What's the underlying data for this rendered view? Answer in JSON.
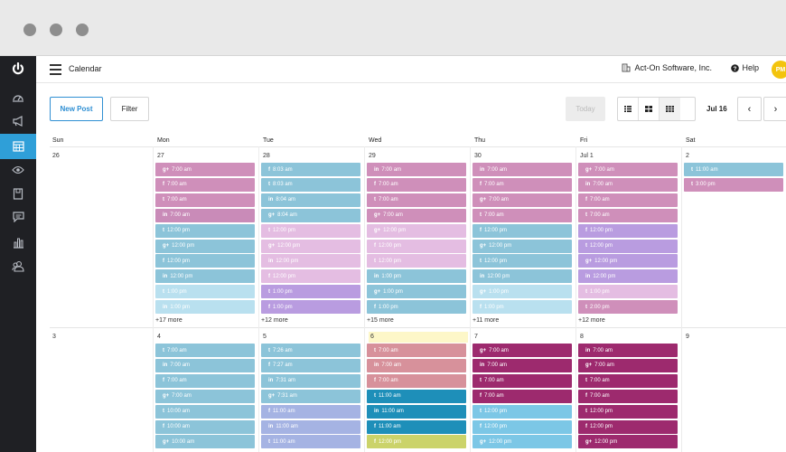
{
  "topbar": {
    "title": "Calendar",
    "company": "Act-On Software, Inc.",
    "help": "Help",
    "avatar": "PM"
  },
  "toolbar": {
    "new_post": "New Post",
    "filter": "Filter",
    "today": "Today",
    "range": "Jul 16",
    "prev": "‹",
    "next": "›"
  },
  "colors": {
    "facebook": "#7fb7d4",
    "twitter": "#8ec6da",
    "linkedin": "#d095bf",
    "google": "#cf8fb9",
    "highlight": "#fdf7c8"
  },
  "weekdays": [
    "Sun",
    "Mon",
    "Tue",
    "Wed",
    "Thu",
    "Fri",
    "Sat"
  ],
  "weeks": [
    {
      "dates": [
        "26",
        "27",
        "28",
        "29",
        "30",
        "Jul 1",
        "2"
      ],
      "days": [
        {
          "events": [],
          "more": ""
        },
        {
          "events": [
            {
              "icon": "g+",
              "time": "7:00 am",
              "color": "#cf8fba"
            },
            {
              "icon": "f",
              "time": "7:00 am",
              "color": "#cf8fba"
            },
            {
              "icon": "t",
              "time": "7:00 am",
              "color": "#cf8fba"
            },
            {
              "icon": "in",
              "time": "7:00 am",
              "color": "#c98bb8"
            },
            {
              "icon": "t",
              "time": "12:00 pm",
              "color": "#8cc4d9"
            },
            {
              "icon": "g+",
              "time": "12:00 pm",
              "color": "#8cc4d9"
            },
            {
              "icon": "f",
              "time": "12:00 pm",
              "color": "#8cc4d9"
            },
            {
              "icon": "in",
              "time": "12:00 pm",
              "color": "#8cc4d9"
            },
            {
              "icon": "t",
              "time": "1:00 pm",
              "color": "#b9e0ef"
            },
            {
              "icon": "in",
              "time": "1:00 pm",
              "color": "#b9e0ef"
            }
          ],
          "more": "+17 more"
        },
        {
          "events": [
            {
              "icon": "f",
              "time": "8:03 am",
              "color": "#8cc4d9"
            },
            {
              "icon": "t",
              "time": "8:03 am",
              "color": "#8cc4d9"
            },
            {
              "icon": "in",
              "time": "8:04 am",
              "color": "#8cc4d9"
            },
            {
              "icon": "g+",
              "time": "8:04 am",
              "color": "#8cc4d9"
            },
            {
              "icon": "t",
              "time": "12:00 pm",
              "color": "#e4bde2"
            },
            {
              "icon": "g+",
              "time": "12:00 pm",
              "color": "#e4bde2"
            },
            {
              "icon": "in",
              "time": "12:00 pm",
              "color": "#e4bde2"
            },
            {
              "icon": "f",
              "time": "12:00 pm",
              "color": "#e4bde2"
            },
            {
              "icon": "t",
              "time": "1:00 pm",
              "color": "#b99ce0"
            },
            {
              "icon": "f",
              "time": "1:00 pm",
              "color": "#b99ce0"
            }
          ],
          "more": "+12 more"
        },
        {
          "events": [
            {
              "icon": "in",
              "time": "7:00 am",
              "color": "#cf8fba"
            },
            {
              "icon": "f",
              "time": "7:00 am",
              "color": "#cf8fba"
            },
            {
              "icon": "t",
              "time": "7:00 am",
              "color": "#cf8fba"
            },
            {
              "icon": "g+",
              "time": "7:00 am",
              "color": "#cf8fba"
            },
            {
              "icon": "g+",
              "time": "12:00 pm",
              "color": "#e4bde2"
            },
            {
              "icon": "f",
              "time": "12:00 pm",
              "color": "#e4bde2"
            },
            {
              "icon": "t",
              "time": "12:00 pm",
              "color": "#e4bde2"
            },
            {
              "icon": "in",
              "time": "1:00 pm",
              "color": "#8cc4d9"
            },
            {
              "icon": "g+",
              "time": "1:00 pm",
              "color": "#8cc4d9"
            },
            {
              "icon": "f",
              "time": "1:00 pm",
              "color": "#8cc4d9"
            }
          ],
          "more": "+15 more"
        },
        {
          "events": [
            {
              "icon": "in",
              "time": "7:00 am",
              "color": "#cf8fba"
            },
            {
              "icon": "f",
              "time": "7:00 am",
              "color": "#cf8fba"
            },
            {
              "icon": "g+",
              "time": "7:00 am",
              "color": "#cf8fba"
            },
            {
              "icon": "t",
              "time": "7:00 am",
              "color": "#cf8fba"
            },
            {
              "icon": "f",
              "time": "12:00 pm",
              "color": "#8cc4d9"
            },
            {
              "icon": "g+",
              "time": "12:00 pm",
              "color": "#8cc4d9"
            },
            {
              "icon": "t",
              "time": "12:00 pm",
              "color": "#8cc4d9"
            },
            {
              "icon": "in",
              "time": "12:00 pm",
              "color": "#8cc4d9"
            },
            {
              "icon": "g+",
              "time": "1:00 pm",
              "color": "#b9e0ef"
            },
            {
              "icon": "f",
              "time": "1:00 pm",
              "color": "#b9e0ef"
            }
          ],
          "more": "+11 more"
        },
        {
          "events": [
            {
              "icon": "g+",
              "time": "7:00 am",
              "color": "#cf8fba"
            },
            {
              "icon": "in",
              "time": "7:00 am",
              "color": "#cf8fba"
            },
            {
              "icon": "f",
              "time": "7:00 am",
              "color": "#cf8fba"
            },
            {
              "icon": "t",
              "time": "7:00 am",
              "color": "#cf8fba"
            },
            {
              "icon": "f",
              "time": "12:00 pm",
              "color": "#b99ce0"
            },
            {
              "icon": "t",
              "time": "12:00 pm",
              "color": "#b99ce0"
            },
            {
              "icon": "g+",
              "time": "12:00 pm",
              "color": "#b99ce0"
            },
            {
              "icon": "in",
              "time": "12:00 pm",
              "color": "#b99ce0"
            },
            {
              "icon": "t",
              "time": "1:00 pm",
              "color": "#e4bde2"
            },
            {
              "icon": "t",
              "time": "2:00 pm",
              "color": "#cf8fba"
            }
          ],
          "more": "+12 more"
        },
        {
          "events": [
            {
              "icon": "t",
              "time": "11:00 am",
              "color": "#8cc4d9"
            },
            {
              "icon": "t",
              "time": "3:00 pm",
              "color": "#cf8fba"
            }
          ],
          "more": ""
        }
      ]
    },
    {
      "dates": [
        "3",
        "4",
        "5",
        "6",
        "7",
        "8",
        "9"
      ],
      "days": [
        {
          "events": [],
          "more": ""
        },
        {
          "events": [
            {
              "icon": "t",
              "time": "7:00 am",
              "color": "#8cc4d9"
            },
            {
              "icon": "in",
              "time": "7:00 am",
              "color": "#8cc4d9"
            },
            {
              "icon": "f",
              "time": "7:00 am",
              "color": "#8cc4d9"
            },
            {
              "icon": "g+",
              "time": "7:00 am",
              "color": "#8cc4d9"
            },
            {
              "icon": "t",
              "time": "10:00 am",
              "color": "#8cc4d9"
            },
            {
              "icon": "f",
              "time": "10:00 am",
              "color": "#8cc4d9"
            },
            {
              "icon": "g+",
              "time": "10:00 am",
              "color": "#8cc4d9"
            }
          ],
          "more": ""
        },
        {
          "events": [
            {
              "icon": "t",
              "time": "7:26 am",
              "color": "#8cc4d9"
            },
            {
              "icon": "f",
              "time": "7:27 am",
              "color": "#8cc4d9"
            },
            {
              "icon": "in",
              "time": "7:31 am",
              "color": "#8cc4d9"
            },
            {
              "icon": "g+",
              "time": "7:31 am",
              "color": "#8cc4d9"
            },
            {
              "icon": "f",
              "time": "11:00 am",
              "color": "#a5b3e3"
            },
            {
              "icon": "in",
              "time": "11:00 am",
              "color": "#a5b3e3"
            },
            {
              "icon": "t",
              "time": "11:00 am",
              "color": "#a5b3e3"
            }
          ],
          "more": ""
        },
        {
          "events": [
            {
              "icon": "t",
              "time": "7:00 am",
              "color": "#d7919b"
            },
            {
              "icon": "in",
              "time": "7:00 am",
              "color": "#d7919b"
            },
            {
              "icon": "f",
              "time": "7:00 am",
              "color": "#d7919b"
            },
            {
              "icon": "t",
              "time": "11:00 am",
              "color": "#1e8fb9"
            },
            {
              "icon": "in",
              "time": "11:00 am",
              "color": "#1e8fb9"
            },
            {
              "icon": "f",
              "time": "11:00 am",
              "color": "#1e8fb9"
            },
            {
              "icon": "f",
              "time": "12:00 pm",
              "color": "#cbd36a"
            }
          ],
          "more": ""
        },
        {
          "events": [
            {
              "icon": "g+",
              "time": "7:00 am",
              "color": "#9d2a6e"
            },
            {
              "icon": "in",
              "time": "7:00 am",
              "color": "#9d2a6e"
            },
            {
              "icon": "t",
              "time": "7:00 am",
              "color": "#9d2a6e"
            },
            {
              "icon": "f",
              "time": "7:00 am",
              "color": "#9d2a6e"
            },
            {
              "icon": "t",
              "time": "12:00 pm",
              "color": "#7cc7e6"
            },
            {
              "icon": "f",
              "time": "12:00 pm",
              "color": "#7cc7e6"
            },
            {
              "icon": "g+",
              "time": "12:00 pm",
              "color": "#7cc7e6"
            }
          ],
          "more": ""
        },
        {
          "events": [
            {
              "icon": "in",
              "time": "7:00 am",
              "color": "#9d2a6e"
            },
            {
              "icon": "g+",
              "time": "7:00 am",
              "color": "#9d2a6e"
            },
            {
              "icon": "t",
              "time": "7:00 am",
              "color": "#9d2a6e"
            },
            {
              "icon": "f",
              "time": "7:00 am",
              "color": "#9d2a6e"
            },
            {
              "icon": "t",
              "time": "12:00 pm",
              "color": "#9d2a6e"
            },
            {
              "icon": "f",
              "time": "12:00 pm",
              "color": "#9d2a6e"
            },
            {
              "icon": "g+",
              "time": "12:00 pm",
              "color": "#9d2a6e"
            }
          ],
          "more": ""
        },
        {
          "events": [],
          "more": ""
        }
      ]
    }
  ]
}
